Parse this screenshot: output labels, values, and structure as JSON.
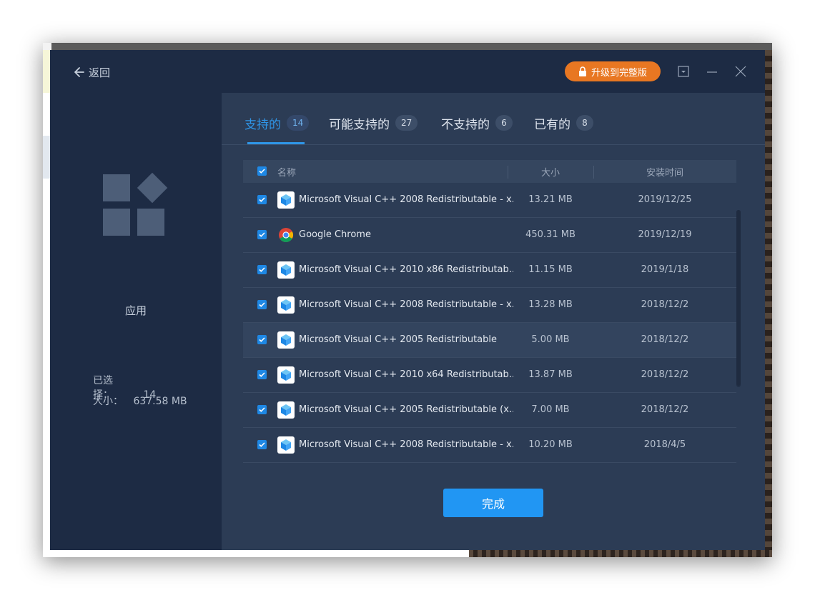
{
  "titlebar": {
    "back_label": "返回",
    "upgrade_label": "升级到完整版",
    "accent": "#e87722"
  },
  "sidebar": {
    "category_label": "应用",
    "selected_label": "已选择：",
    "selected_value": "14",
    "size_label": "大小：",
    "size_value": "637.58 MB"
  },
  "tabs": [
    {
      "label": "支持的",
      "count": "14",
      "active": true
    },
    {
      "label": "可能支持的",
      "count": "27",
      "active": false
    },
    {
      "label": "不支持的",
      "count": "6",
      "active": false
    },
    {
      "label": "已有的",
      "count": "8",
      "active": false
    }
  ],
  "table": {
    "columns": [
      "名称",
      "大小",
      "安装时间"
    ],
    "rows": [
      {
        "name": "Microsoft Visual C++ 2008 Redistributable - x...",
        "size": "13.21 MB",
        "date": "2019/12/25",
        "icon": "package-icon",
        "checked": true
      },
      {
        "name": "Google Chrome",
        "size": "450.31 MB",
        "date": "2019/12/19",
        "icon": "chrome-icon",
        "checked": true
      },
      {
        "name": "Microsoft Visual C++ 2010  x86 Redistributab...",
        "size": "11.15 MB",
        "date": "2019/1/18",
        "icon": "package-icon",
        "checked": true
      },
      {
        "name": "Microsoft Visual C++ 2008 Redistributable - x...",
        "size": "13.28 MB",
        "date": "2018/12/2",
        "icon": "package-icon",
        "checked": true
      },
      {
        "name": "Microsoft Visual C++ 2005 Redistributable",
        "size": "5.00 MB",
        "date": "2018/12/2",
        "icon": "package-icon",
        "checked": true
      },
      {
        "name": "Microsoft Visual C++ 2010  x64 Redistributab...",
        "size": "13.87 MB",
        "date": "2018/12/2",
        "icon": "package-icon",
        "checked": true
      },
      {
        "name": "Microsoft Visual C++ 2005 Redistributable (x...",
        "size": "7.00 MB",
        "date": "2018/12/2",
        "icon": "package-icon",
        "checked": true
      },
      {
        "name": "Microsoft Visual C++ 2008 Redistributable - x...",
        "size": "10.20 MB",
        "date": "2018/4/5",
        "icon": "package-icon",
        "checked": true
      }
    ]
  },
  "footer": {
    "done_label": "完成",
    "accent": "#2196f3"
  }
}
